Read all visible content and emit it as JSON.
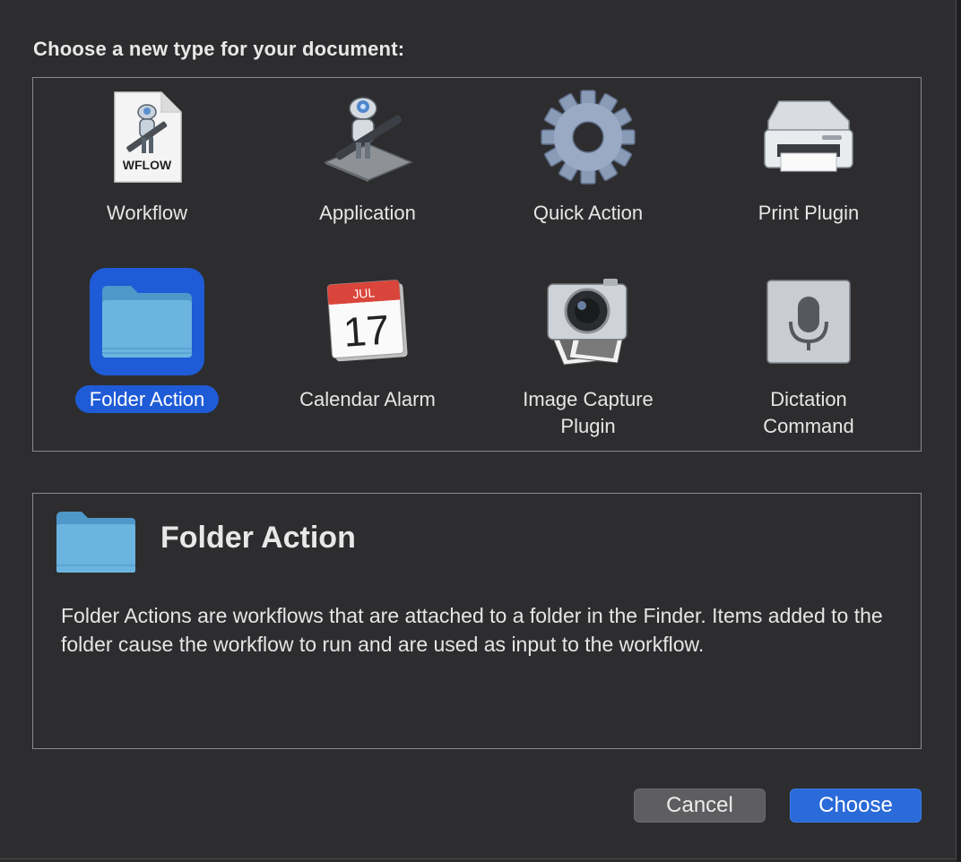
{
  "prompt": "Choose a new type for your document:",
  "types": [
    {
      "label": "Workflow",
      "icon": "workflow-document-icon",
      "badge": "WFLOW"
    },
    {
      "label": "Application",
      "icon": "automator-robot-icon"
    },
    {
      "label": "Quick Action",
      "icon": "gear-icon"
    },
    {
      "label": "Print Plugin",
      "icon": "printer-icon"
    },
    {
      "label": "Folder Action",
      "icon": "folder-icon",
      "selected": true
    },
    {
      "label": "Calendar Alarm",
      "icon": "calendar-icon",
      "month": "JUL",
      "day": "17"
    },
    {
      "label": "Image Capture\nPlugin",
      "icon": "camera-icon"
    },
    {
      "label": "Dictation\nCommand",
      "icon": "microphone-icon"
    }
  ],
  "description": {
    "title": "Folder Action",
    "icon": "folder-icon",
    "body": "Folder Actions are workflows that are attached to a folder in the Finder. Items added to the folder cause the workflow to run and are used as input to the workflow."
  },
  "buttons": {
    "cancel": "Cancel",
    "choose": "Choose"
  },
  "colors": {
    "selection": "#1f5bd6",
    "folder": "#6cb4e0",
    "background": "#2d2d2f"
  }
}
